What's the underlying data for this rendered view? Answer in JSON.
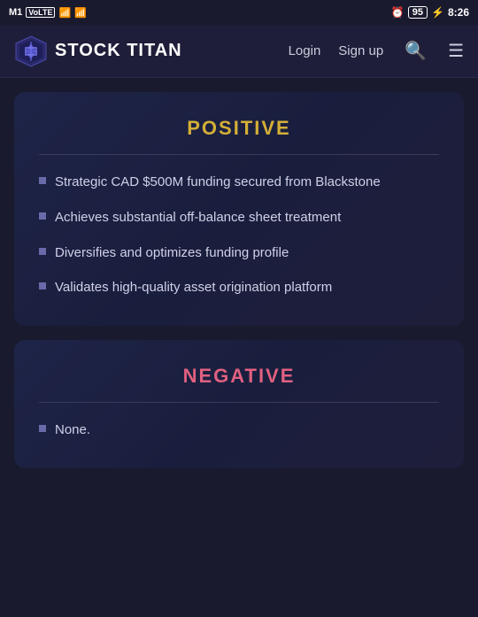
{
  "statusBar": {
    "carrier": "M1",
    "carrierType": "VoLTE",
    "signalBars": "||||",
    "wifi": "wifi",
    "alarmIcon": "⏰",
    "battery": "95",
    "charging": "⚡",
    "time": "8:26"
  },
  "navbar": {
    "logoText": "STOCK TITAN",
    "loginLabel": "Login",
    "signupLabel": "Sign up",
    "searchLabel": "Search",
    "menuLabel": "Menu"
  },
  "positive": {
    "title": "Positive",
    "items": [
      "Strategic CAD $500M funding secured from Blackstone",
      "Achieves substantial off-balance sheet treatment",
      "Diversifies and optimizes funding profile",
      "Validates high-quality asset origination platform"
    ]
  },
  "negative": {
    "title": "Negative",
    "items": [
      "None."
    ]
  }
}
